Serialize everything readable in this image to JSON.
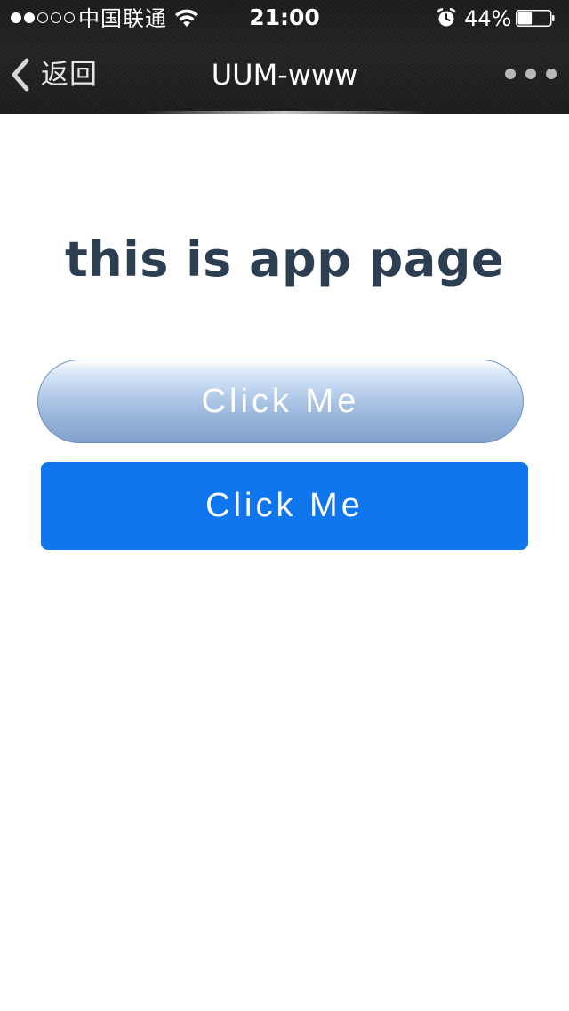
{
  "status_bar": {
    "signal_filled": 2,
    "signal_total": 5,
    "carrier": "中国联通",
    "time": "21:00",
    "battery_percent": "44%",
    "battery_level": 0.44
  },
  "nav_bar": {
    "back_label": "返回",
    "title": "UUM-www",
    "more_icon": "more-dots-icon"
  },
  "main": {
    "heading": "this is app page",
    "primary_button_label": "Click Me",
    "secondary_button_label": "Click Me"
  },
  "colors": {
    "nav_background": "#1f2022",
    "heading_text": "#2c3e52",
    "solid_button": "#1076ee",
    "gradient_button_top": "#dce8f8",
    "gradient_button_bottom": "#83a3cd",
    "button_text": "#ffffff"
  }
}
